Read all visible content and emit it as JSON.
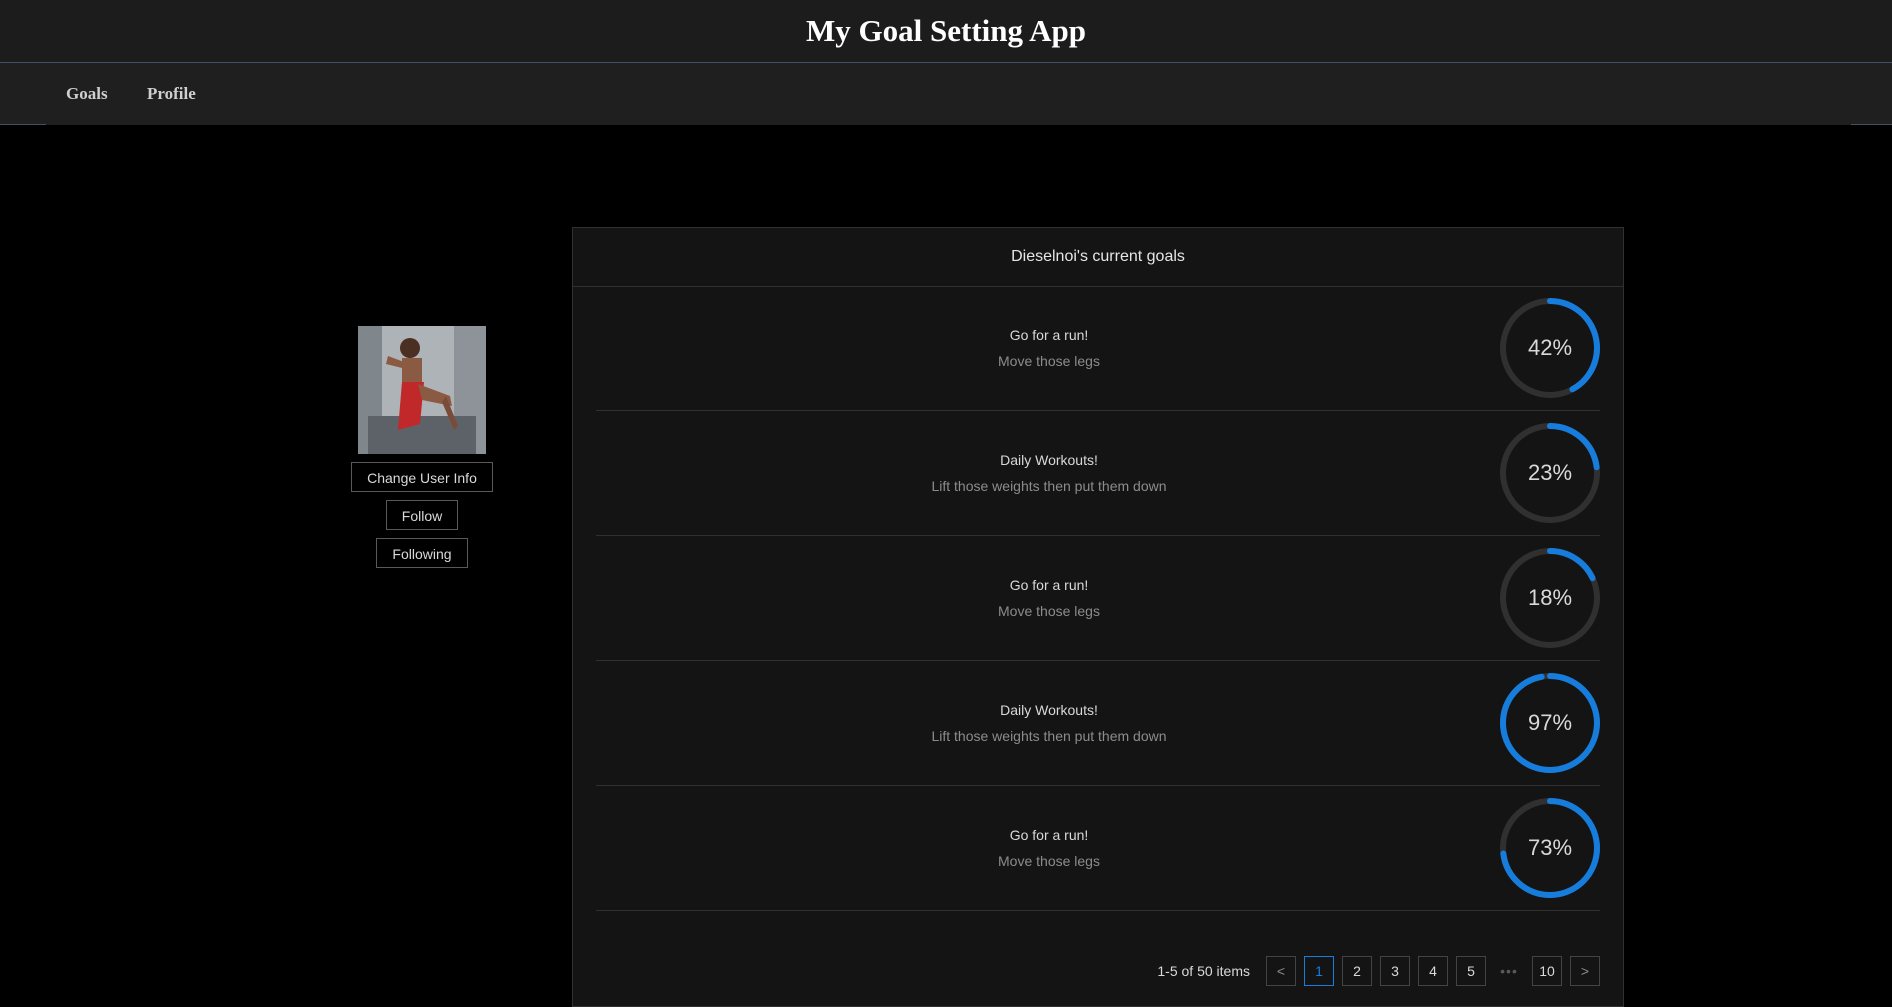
{
  "app": {
    "title": "My Goal Setting App"
  },
  "nav": {
    "items": [
      {
        "label": "Goals"
      },
      {
        "label": "Profile"
      }
    ]
  },
  "profile": {
    "avatar_alt": "User profile photo",
    "buttons": {
      "change_info": "Change User Info",
      "follow": "Follow",
      "following": "Following"
    }
  },
  "goals": {
    "header": "Dieselnoi's current goals",
    "items": [
      {
        "title": "Go for a run!",
        "description": "Move those legs",
        "percent": 42,
        "percent_label": "42%"
      },
      {
        "title": "Daily Workouts!",
        "description": "Lift those weights then put them down",
        "percent": 23,
        "percent_label": "23%"
      },
      {
        "title": "Go for a run!",
        "description": "Move those legs",
        "percent": 18,
        "percent_label": "18%"
      },
      {
        "title": "Daily Workouts!",
        "description": "Lift those weights then put them down",
        "percent": 97,
        "percent_label": "97%"
      },
      {
        "title": "Go for a run!",
        "description": "Move those legs",
        "percent": 73,
        "percent_label": "73%"
      }
    ]
  },
  "pagination": {
    "total_text": "1-5 of 50 items",
    "prev_icon": "chevron-left-icon",
    "next_icon": "chevron-right-icon",
    "pages": [
      "1",
      "2",
      "3",
      "4",
      "5"
    ],
    "ellipsis": "•••",
    "last_page": "10",
    "current": "1"
  },
  "colors": {
    "accent": "#177ddc",
    "track": "#303030",
    "background": "#000000",
    "card": "#141414"
  }
}
